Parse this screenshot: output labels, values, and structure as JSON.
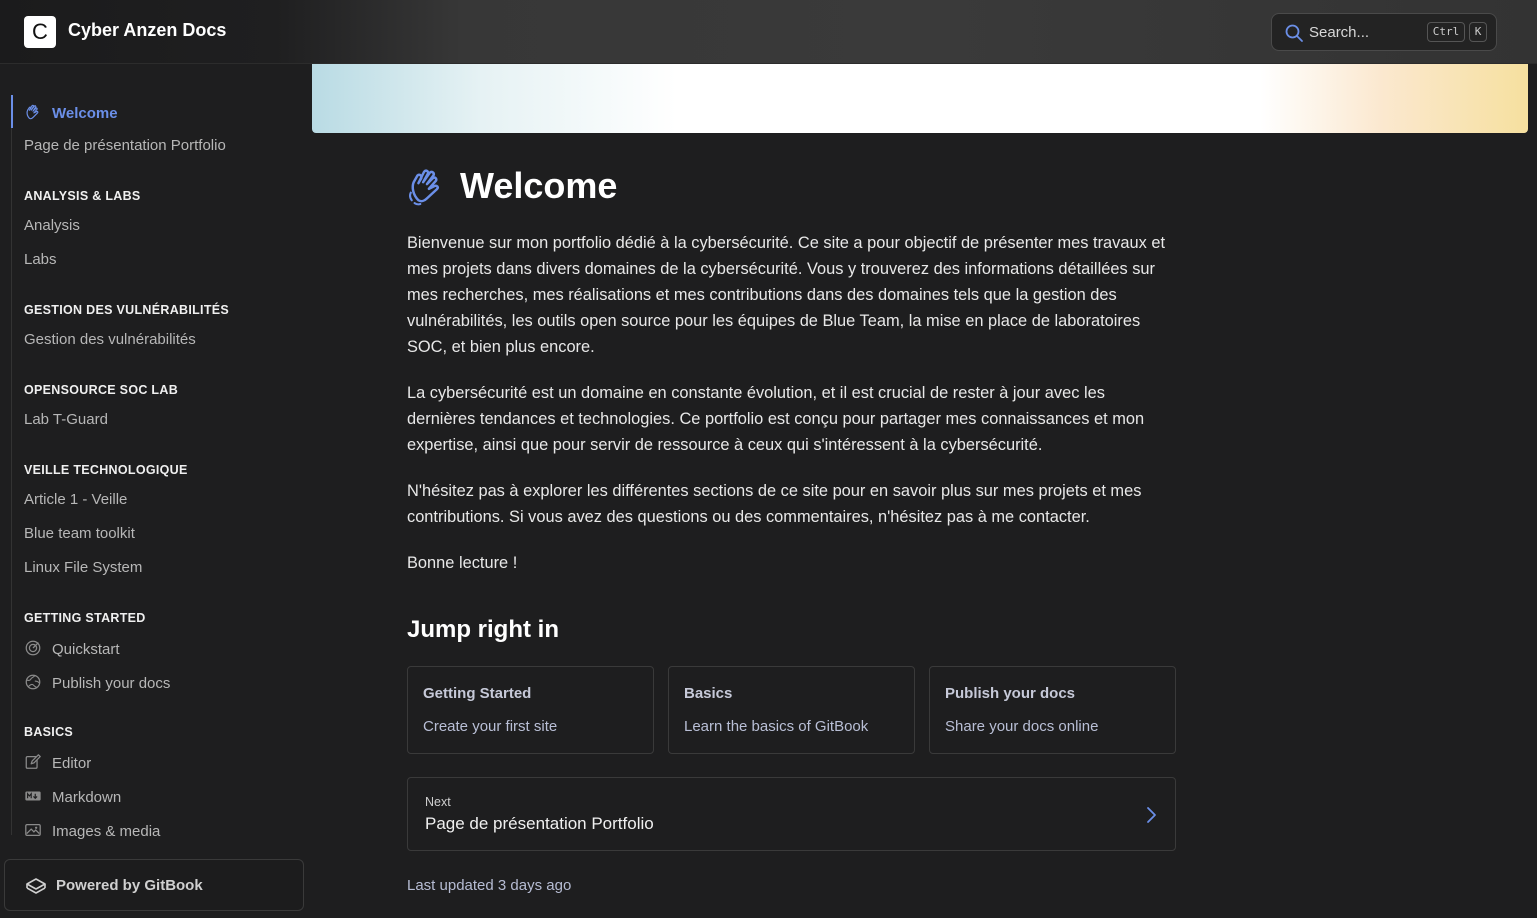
{
  "header": {
    "logo_letter": "C",
    "site_title": "Cyber Anzen Docs",
    "search_placeholder": "Search...",
    "shortcut_ctrl": "Ctrl",
    "shortcut_key": "K"
  },
  "sidebar": {
    "top_items": [
      {
        "label": "Welcome",
        "icon": "wave-hand-icon",
        "active": true
      },
      {
        "label": "Page de présentation Portfolio"
      }
    ],
    "sections": [
      {
        "heading": "ANALYSIS & LABS",
        "items": [
          "Analysis",
          "Labs"
        ]
      },
      {
        "heading": "GESTION DES VULNÉRABILITÉS",
        "items": [
          "Gestion des vulnérabilités"
        ]
      },
      {
        "heading": "OPENSOURCE SOC LAB",
        "items": [
          "Lab T-Guard"
        ]
      },
      {
        "heading": "VEILLE TECHNOLOGIQUE",
        "items": [
          "Article 1 - Veille",
          "Blue team toolkit",
          "Linux File System"
        ]
      },
      {
        "heading": "GETTING STARTED",
        "items": [
          {
            "label": "Quickstart",
            "icon": "target-icon"
          },
          {
            "label": "Publish your docs",
            "icon": "globe-icon"
          }
        ]
      },
      {
        "heading": "BASICS",
        "items": [
          {
            "label": "Editor",
            "icon": "edit-icon"
          },
          {
            "label": "Markdown",
            "icon": "markdown-icon"
          },
          {
            "label": "Images & media",
            "icon": "image-icon"
          }
        ]
      }
    ],
    "powered_by": "Powered by GitBook"
  },
  "main": {
    "title": "Welcome",
    "paragraphs": [
      "Bienvenue sur mon portfolio dédié à la cybersécurité. Ce site a pour objectif de présenter mes travaux et mes projets dans divers domaines de la cybersécurité. Vous y trouverez des informations détaillées sur mes recherches, mes réalisations et mes contributions dans des domaines tels que la gestion des vulnérabilités, les outils open source pour les équipes de Blue Team, la mise en place de laboratoires SOC, et bien plus encore.",
      "La cybersécurité est un domaine en constante évolution, et il est crucial de rester à jour avec les dernières tendances et technologies. Ce portfolio est conçu pour partager mes connaissances et mon expertise, ainsi que pour servir de ressource à ceux qui s'intéressent à la cybersécurité.",
      "N'hésitez pas à explorer les différentes sections de ce site pour en savoir plus sur mes projets et mes contributions. Si vous avez des questions ou des commentaires, n'hésitez pas à me contacter.",
      "Bonne lecture !"
    ],
    "jump_heading": "Jump right in",
    "cards": [
      {
        "title": "Getting Started",
        "desc": "Create your first site"
      },
      {
        "title": "Basics",
        "desc": "Learn the basics of GitBook"
      },
      {
        "title": "Publish your docs",
        "desc": "Share your docs online"
      }
    ],
    "next": {
      "label": "Next",
      "title": "Page de présentation Portfolio"
    },
    "last_updated": "Last updated 3 days ago"
  },
  "colors": {
    "accent": "#6b8fe8",
    "background": "#1e1e1f"
  }
}
